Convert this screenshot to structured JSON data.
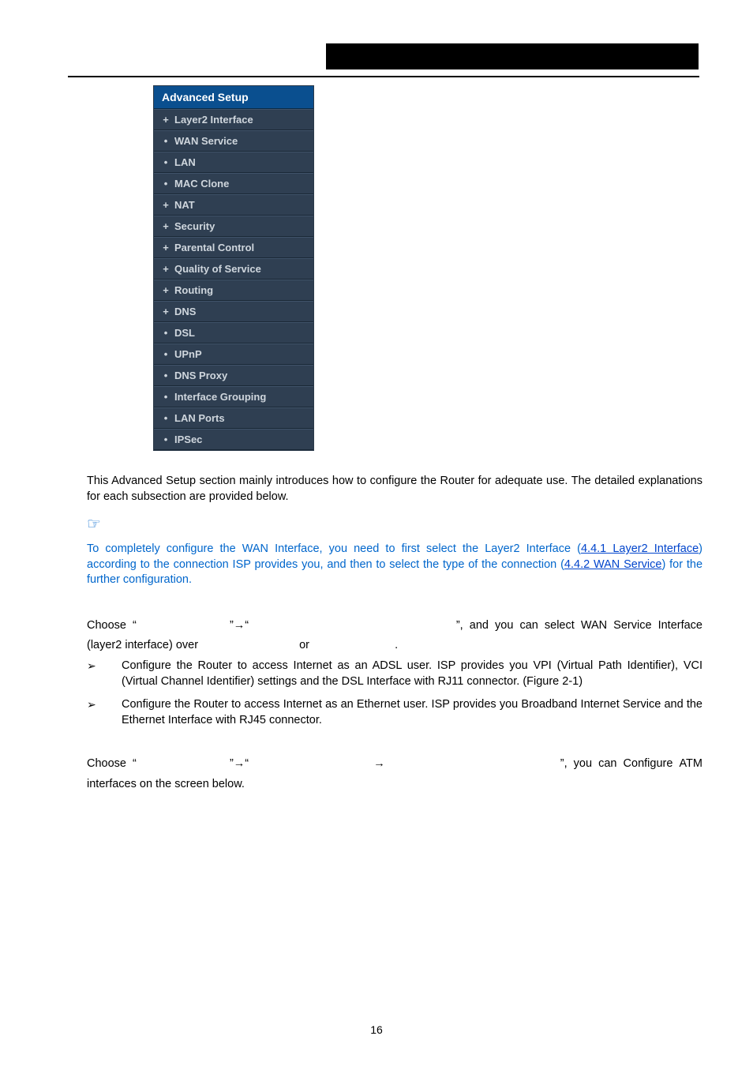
{
  "sidebar": {
    "header": "Advanced Setup",
    "items": [
      {
        "glyph": "+",
        "label": "Layer2 Interface"
      },
      {
        "glyph": "•",
        "label": "WAN Service"
      },
      {
        "glyph": "•",
        "label": "LAN"
      },
      {
        "glyph": "•",
        "label": "MAC Clone"
      },
      {
        "glyph": "+",
        "label": "NAT"
      },
      {
        "glyph": "+",
        "label": "Security"
      },
      {
        "glyph": "+",
        "label": "Parental Control"
      },
      {
        "glyph": "+",
        "label": "Quality of Service"
      },
      {
        "glyph": "+",
        "label": "Routing"
      },
      {
        "glyph": "+",
        "label": "DNS"
      },
      {
        "glyph": "•",
        "label": "DSL"
      },
      {
        "glyph": "•",
        "label": "UPnP"
      },
      {
        "glyph": "•",
        "label": "DNS Proxy"
      },
      {
        "glyph": "•",
        "label": "Interface Grouping"
      },
      {
        "glyph": "•",
        "label": "LAN Ports"
      },
      {
        "glyph": "•",
        "label": "IPSec"
      }
    ]
  },
  "intro": "This Advanced Setup section mainly introduces how to configure the Router for adequate use. The detailed explanations for each subsection are provided below.",
  "note_icon": "☞",
  "note": {
    "pre": "To completely configure the WAN Interface, you need to first select the Layer2 Interface (",
    "link1": "4.4.1 Layer2 Interface",
    "mid": ") according to the connection ISP provides you, and then to select the type of the connection (",
    "link2": "4.4.2 WAN Service",
    "post": ") for the further configuration."
  },
  "sec441": {
    "choose_line": {
      "a": "Choose  “",
      "b": "”",
      "arrow1": "→",
      "c": "“",
      "d": "”,  and  you  can  select  WAN  Service  Interface",
      "line2_a": "(layer2 interface) over",
      "line2_or": "or",
      "line2_dot": "."
    },
    "bullets": [
      "Configure the Router to access Internet as an ADSL user. ISP provides you VPI (Virtual Path Identifier), VCI (Virtual Channel Identifier) settings and the DSL Interface with RJ11 connector. (Figure 2-1)",
      "Configure the Router to access Internet as an Ethernet user. ISP provides you Broadband Internet Service and the Ethernet Interface with RJ45 connector."
    ]
  },
  "sec_atm": {
    "a": "Choose  “",
    "b": "”",
    "arrow1": "→",
    "c": "“",
    "arrow2": "→",
    "d": "”,  you  can  Configure  ATM",
    "line2": "interfaces on the screen below."
  },
  "page_number": "16",
  "glyphs": {
    "tri": "➢"
  }
}
